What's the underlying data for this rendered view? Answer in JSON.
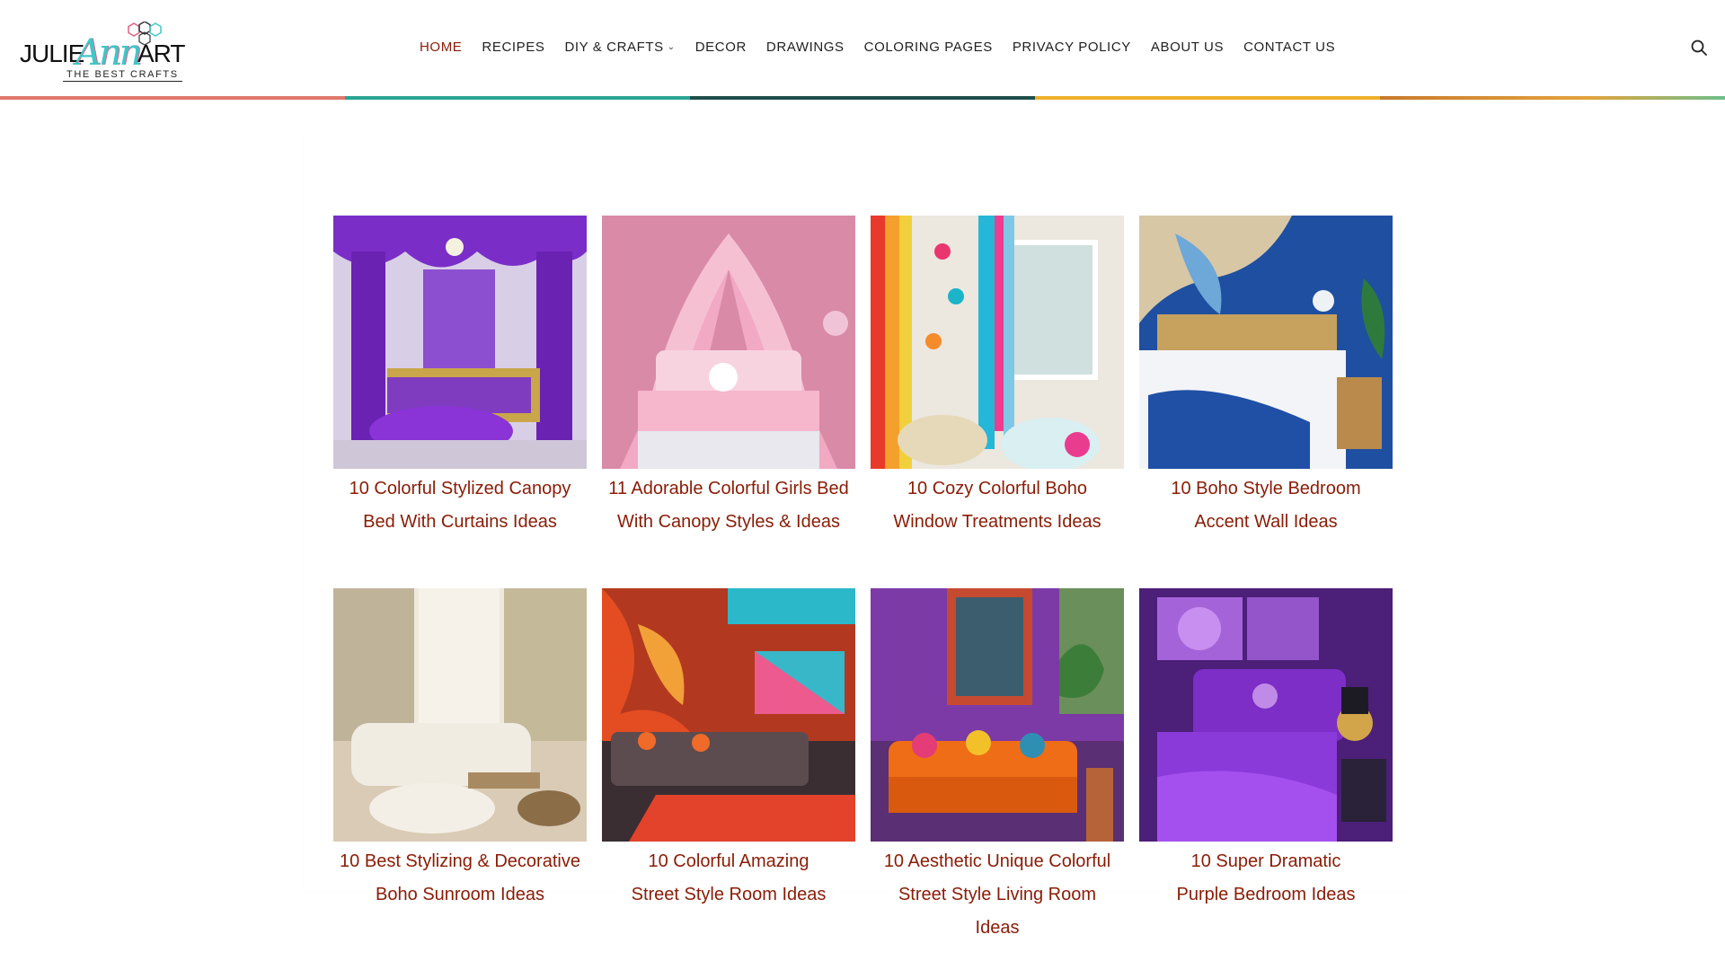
{
  "brand": {
    "name_part1": "JULIE",
    "name_part2": "Ann",
    "name_part3": "ART",
    "tagline": "THE BEST CRAFTS"
  },
  "nav": {
    "items": [
      {
        "label": "HOME",
        "active": true
      },
      {
        "label": "RECIPES"
      },
      {
        "label": "DIY & CRAFTS",
        "dropdown": true
      },
      {
        "label": "DECOR"
      },
      {
        "label": "DRAWINGS"
      },
      {
        "label": "COLORING PAGES"
      },
      {
        "label": "PRIVACY POLICY"
      },
      {
        "label": "ABOUT US"
      },
      {
        "label": "CONTACT US"
      }
    ],
    "search_icon": "search-icon"
  },
  "colors": {
    "accent": "#8a1c05",
    "stripe": [
      "#e0786c",
      "#2aa493",
      "#1f4f4b",
      "#efb12a",
      "#c87a2c"
    ]
  },
  "posts": [
    {
      "title_line1": "10 Colorful Stylized Canopy",
      "title_line2": "Bed With Curtains Ideas"
    },
    {
      "title_line1": "11 Adorable Colorful Girls Bed",
      "title_line2": "With Canopy Styles & Ideas"
    },
    {
      "title_line1": "10 Cozy Colorful Boho",
      "title_line2": "Window Treatments Ideas"
    },
    {
      "title_line1": "10 Boho Style Bedroom",
      "title_line2": "Accent Wall Ideas"
    },
    {
      "title_line1": "10 Best Stylizing & Decorative",
      "title_line2": "Boho Sunroom Ideas"
    },
    {
      "title_line1": "10 Colorful Amazing",
      "title_line2": "Street Style Room Ideas"
    },
    {
      "title_line1": "10 Aesthetic Unique Colorful",
      "title_line2": "Street Style Living Room Ideas"
    },
    {
      "title_line1": "10 Super Dramatic",
      "title_line2": "Purple Bedroom Ideas"
    }
  ]
}
